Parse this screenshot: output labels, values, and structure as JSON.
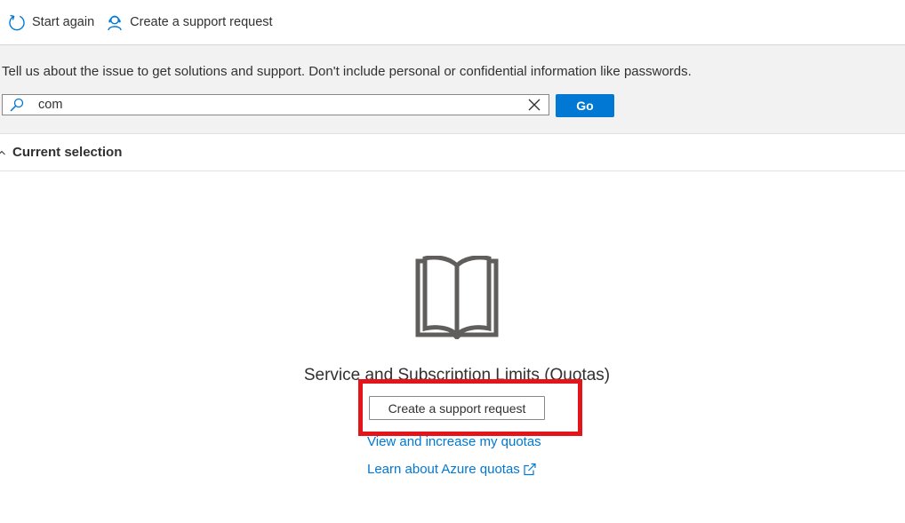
{
  "toolbar": {
    "start_again_label": "Start again",
    "create_support_label": "Create a support request"
  },
  "prompt": {
    "text": "Tell us about the issue to get solutions and support. Don't include personal or confidential information like passwords.",
    "search_value": "com",
    "go_label": "Go"
  },
  "current_selection": {
    "label": "Current selection"
  },
  "result": {
    "title": "Service and Subscription Limits (Quotas)",
    "support_button_label": "Create a support request",
    "links": {
      "quotas": "View and increase my quotas",
      "learn": "Learn about Azure quotas"
    }
  },
  "icons": {
    "restart": "restart-icon",
    "support": "support-person-icon",
    "search": "search-icon",
    "clear": "close-icon",
    "chevron": "chevron-up-icon",
    "book": "book-icon",
    "external": "external-link-icon"
  },
  "colors": {
    "accent": "#0078d4",
    "highlight": "#e3151a",
    "panel_background": "#f2f2f2"
  }
}
